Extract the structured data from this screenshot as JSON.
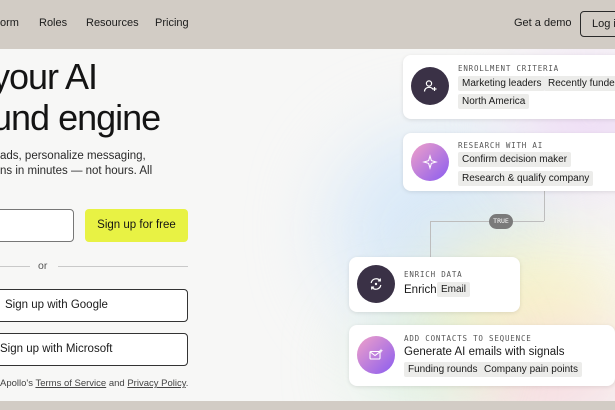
{
  "nav": {
    "items": [
      "orm",
      "Roles",
      "Resources",
      "Pricing"
    ],
    "demo_label": "Get a demo",
    "login_label": "Log in"
  },
  "hero": {
    "headline_line1": "your AI",
    "headline_line2": "und engine",
    "sub_line1": "ads, personalize messaging,",
    "sub_line2": "ns in minutes — not hours. All",
    "cta_label": "Sign up for free",
    "or_label": "or",
    "google_label": "Sign up with Google",
    "microsoft_label": "Sign up with Microsoft",
    "terms_prefix": "Apollo's",
    "terms_link": "Terms of Service",
    "terms_and": "and",
    "privacy_link": "Privacy Policy",
    "terms_suffix": "."
  },
  "workflow": {
    "enrollment": {
      "title": "ENROLLMENT CRITERIA",
      "chips": [
        "Marketing leaders",
        "Recently funded",
        "North America"
      ]
    },
    "research": {
      "title": "RESEARCH WITH AI",
      "chips": [
        "Confirm decision maker",
        "Research & qualify company"
      ]
    },
    "badge": "TRUE",
    "enrich": {
      "title": "ENRICH DATA",
      "text": "Enrich",
      "chip": "Email"
    },
    "sequence": {
      "title": "ADD CONTACTS TO SEQUENCE",
      "text": "Generate AI emails with signals",
      "chips": [
        "Funding rounds",
        "Company pain points"
      ]
    }
  },
  "colors": {
    "nav_bg": "#d2ccc5",
    "cta_bg": "#e8f244",
    "icon_dark": "#3a3146",
    "icon_gradient_start": "#f0a1c8",
    "icon_gradient_end": "#8a5cf0"
  },
  "icons": {
    "enrollment": "user-plus-sparkle-icon",
    "research": "sparkle-icon",
    "enrich": "refresh-sync-icon",
    "sequence": "mail-sparkle-icon"
  }
}
